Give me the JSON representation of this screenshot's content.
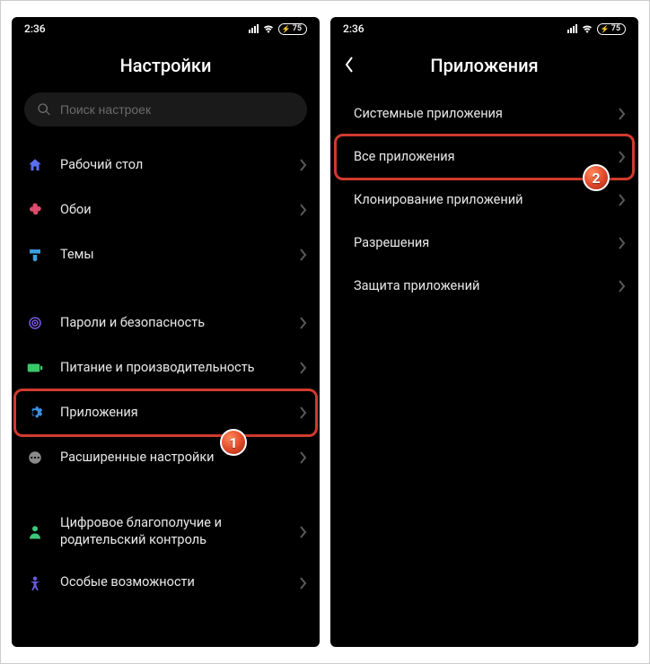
{
  "status": {
    "time": "2:36",
    "battery": "75"
  },
  "left": {
    "title": "Настройки",
    "search_placeholder": "Поиск настроек",
    "items": [
      {
        "label": "Рабочий стол"
      },
      {
        "label": "Обои"
      },
      {
        "label": "Темы"
      },
      {
        "label": "Пароли и безопасность"
      },
      {
        "label": "Питание и производительность"
      },
      {
        "label": "Приложения"
      },
      {
        "label": "Расширенные настройки"
      },
      {
        "label": "Цифровое благополучие и родительский контроль"
      },
      {
        "label": "Особые возможности"
      }
    ]
  },
  "right": {
    "title": "Приложения",
    "items": [
      {
        "label": "Системные приложения"
      },
      {
        "label": "Все приложения"
      },
      {
        "label": "Клонирование приложений"
      },
      {
        "label": "Разрешения"
      },
      {
        "label": "Защита приложений"
      }
    ]
  },
  "annotations": {
    "badge1": "1",
    "badge2": "2"
  }
}
